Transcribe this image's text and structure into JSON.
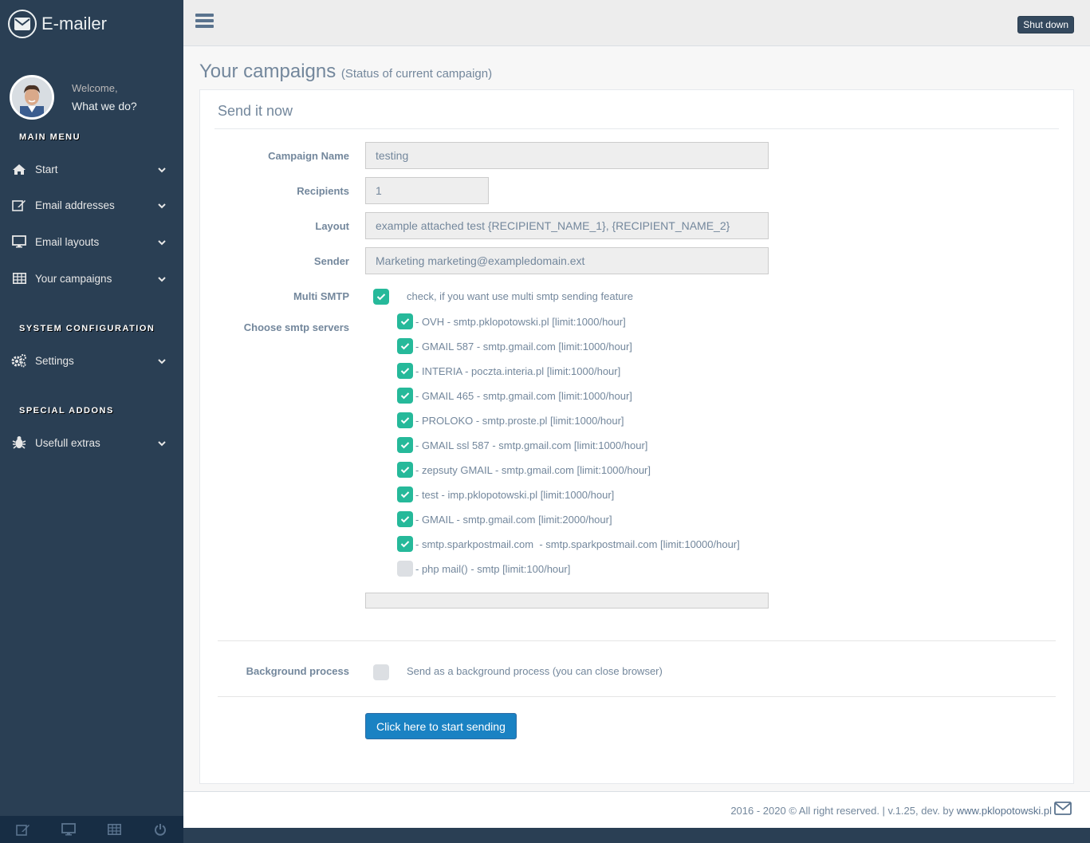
{
  "app": {
    "title": "E-mailer"
  },
  "profile": {
    "welcome": "Welcome,",
    "subtitle": "What we do?"
  },
  "sidebar": {
    "sections": [
      {
        "title": "MAIN MENU"
      },
      {
        "title": "SYSTEM CONFIGURATION"
      },
      {
        "title": "SPECIAL ADDONS"
      }
    ],
    "items": [
      {
        "label": "Start",
        "icon": "home-icon"
      },
      {
        "label": "Email addresses",
        "icon": "edit-icon"
      },
      {
        "label": "Email layouts",
        "icon": "desktop-icon"
      },
      {
        "label": "Your campaigns",
        "icon": "table-icon"
      },
      {
        "label": "Settings",
        "icon": "cogs-icon"
      },
      {
        "label": "Usefull extras",
        "icon": "bug-icon"
      }
    ],
    "footer_icons": [
      "edit-icon",
      "desktop-icon",
      "table-icon",
      "power-icon"
    ]
  },
  "topnav": {
    "shutdown_label": "Shut down"
  },
  "page": {
    "title": "Your campaigns",
    "subtitle": "(Status of current campaign)"
  },
  "panel": {
    "title": "Send it now",
    "labels": {
      "campaign_name": "Campaign Name",
      "recipients": "Recipients",
      "layout": "Layout",
      "sender": "Sender",
      "multi_smtp": "Multi SMTP",
      "choose_smtp": "Choose smtp servers",
      "background": "Background process"
    },
    "values": {
      "campaign_name": "testing",
      "recipients": "1",
      "layout": "example attached test {RECIPIENT_NAME_1}, {RECIPIENT_NAME_2}",
      "sender": "Marketing marketing@exampledomain.ext"
    },
    "multi_smtp_text": "check, if you want use multi smtp sending feature",
    "multi_smtp_checked": true,
    "servers": [
      {
        "label": "- OVH - smtp.pklopotowski.pl [limit:1000/hour]",
        "checked": true
      },
      {
        "label": "- GMAIL 587 - smtp.gmail.com [limit:1000/hour]",
        "checked": true
      },
      {
        "label": "- INTERIA - poczta.interia.pl [limit:1000/hour]",
        "checked": true
      },
      {
        "label": "- GMAIL 465 - smtp.gmail.com [limit:1000/hour]",
        "checked": true
      },
      {
        "label": "- PROLOKO - smtp.proste.pl [limit:1000/hour]",
        "checked": true
      },
      {
        "label": "- GMAIL ssl 587 - smtp.gmail.com [limit:1000/hour]",
        "checked": true
      },
      {
        "label": "- zepsuty GMAIL - smtp.gmail.com [limit:1000/hour]",
        "checked": true
      },
      {
        "label": "- test - imp.pklopotowski.pl [limit:1000/hour]",
        "checked": true
      },
      {
        "label": "- GMAIL - smtp.gmail.com [limit:2000/hour]",
        "checked": true
      },
      {
        "label": "- smtp.sparkpostmail.com  - smtp.sparkpostmail.com [limit:10000/hour]",
        "checked": true
      },
      {
        "label": "- php mail() - smtp [limit:100/hour]",
        "checked": false
      }
    ],
    "background_text": "Send as a background process (you can close browser)",
    "background_checked": false,
    "send_button": "Click here to start sending"
  },
  "footer": {
    "text": "2016 - 2020 © All right reserved. | v.1.25, dev. by ",
    "link": "www.pklopotowski.pl"
  },
  "colors": {
    "sidebar": "#2A3F54",
    "checked": "#26B99A",
    "button": "#1A82C3"
  }
}
